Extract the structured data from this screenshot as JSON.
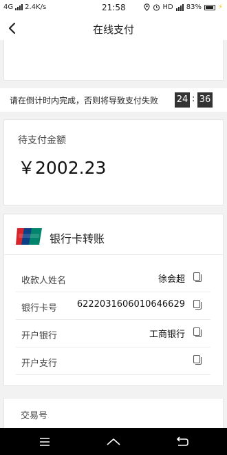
{
  "status_bar": {
    "network": "4G",
    "speed": "2.4K/s",
    "time": "21:58",
    "hd": "HD",
    "battery": "83%"
  },
  "nav": {
    "title": "在线支付"
  },
  "countdown": {
    "text": "请在倒计时内完成，否则将导致支付失败",
    "hours": "24",
    "minutes": "36"
  },
  "amount": {
    "label": "待支付金额",
    "value": "￥2002.23"
  },
  "bank": {
    "title": "银行卡转账",
    "rows": [
      {
        "label": "收款人姓名",
        "value": "徐会超"
      },
      {
        "label": "银行卡号",
        "value": "6222031606010646629"
      },
      {
        "label": "开户银行",
        "value": "工商银行"
      },
      {
        "label": "开户支行",
        "value": ""
      }
    ]
  },
  "transaction": {
    "label": "交易号"
  },
  "colors": {
    "countdown_box": "#333333",
    "bolt": "#f5c400"
  }
}
